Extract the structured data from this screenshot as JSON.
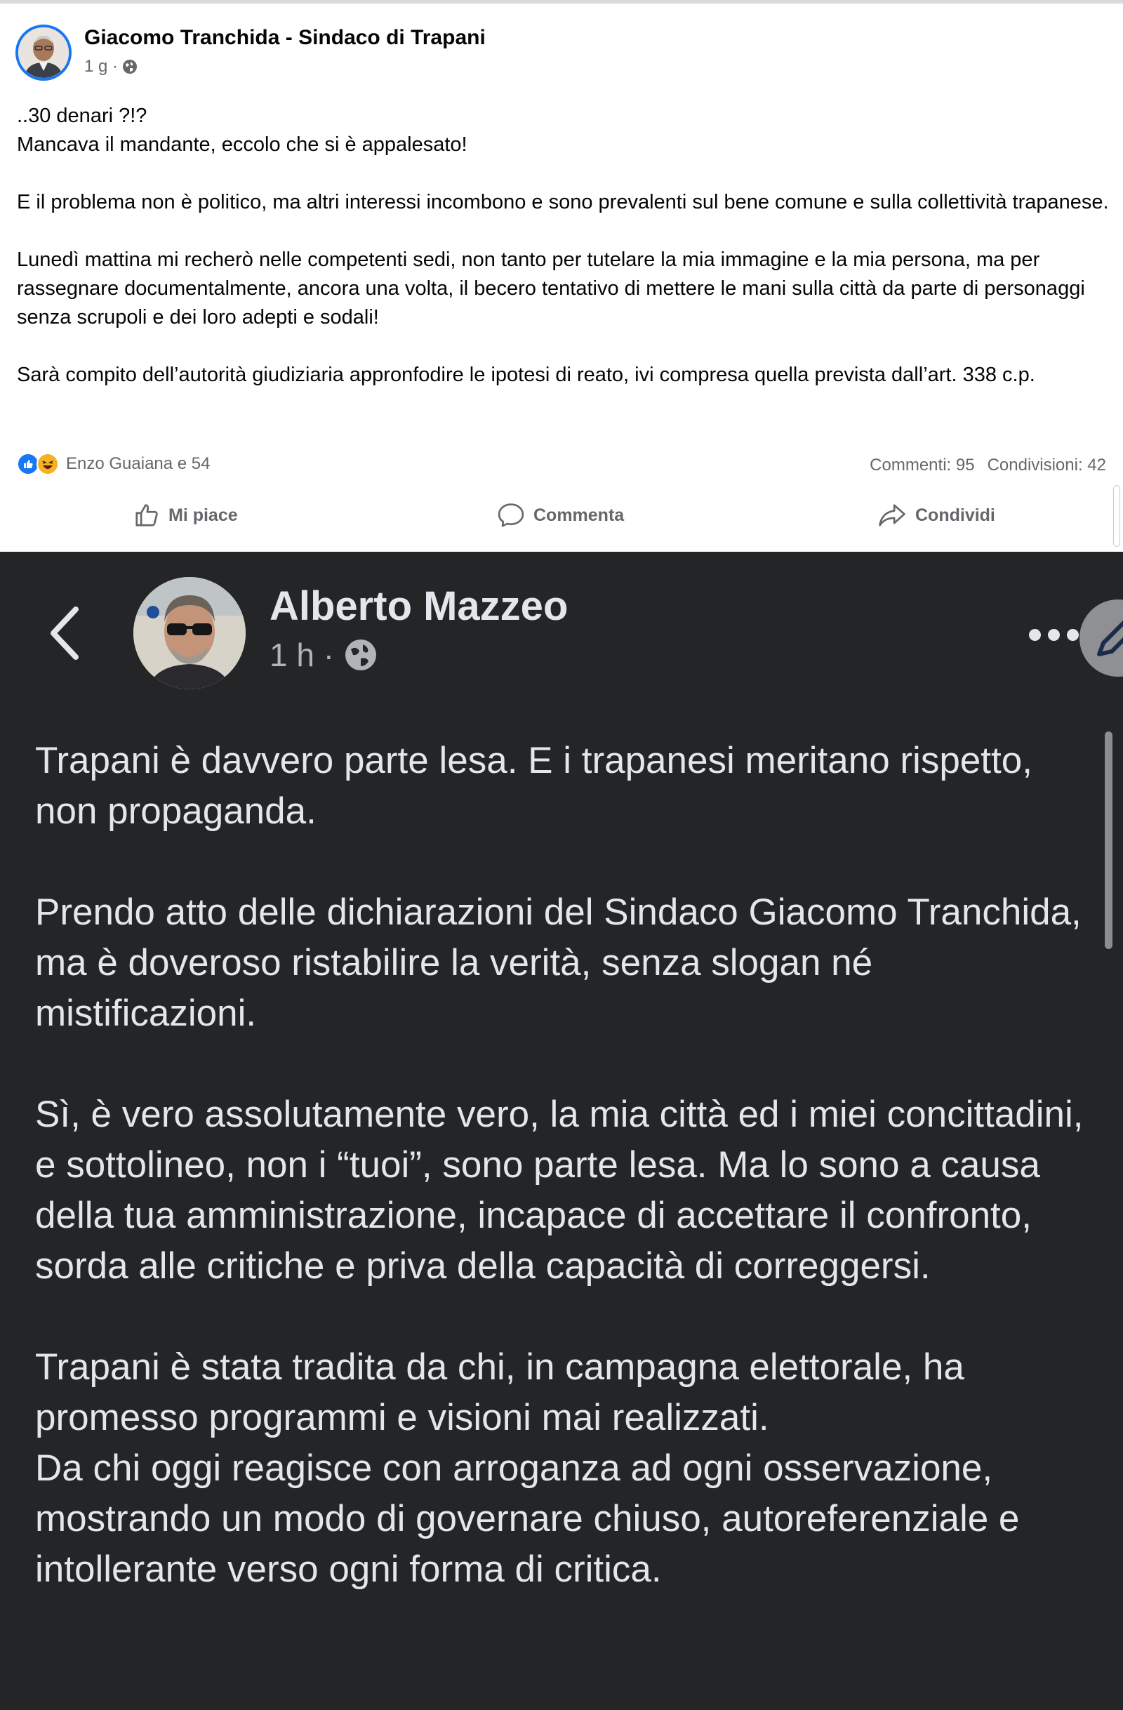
{
  "top_post": {
    "author": "Giacomo Tranchida - Sindaco di Trapani",
    "time": "1 g ·",
    "paragraphs": [
      "..30 denari ?!?\nMancava il mandante, eccolo che si è appalesato!",
      "E il problema non è politico, ma altri interessi incombono e sono prevalenti sul bene comune e sulla collettività trapanese.",
      "Lunedì mattina mi recherò nelle competenti sedi, non tanto per tutelare la mia immagine e la mia persona, ma per rassegnare  documentalmente, ancora una volta,  il becero tentativo di mettere le mani sulla città da parte di personaggi senza scrupoli e dei loro adepti e sodali!",
      "Sarà compito dell’autorità giudiziaria appronfodire le ipotesi di reato, ivi compresa quella prevista dall’art. 338 c.p."
    ],
    "reactions_text": "Enzo Guaiana e 54",
    "comments": "Commenti: 95",
    "shares": "Condivisioni: 42",
    "actions": {
      "like": "Mi piace",
      "comment": "Commenta",
      "share": "Condividi"
    },
    "icons": {
      "audience": "globe-icon",
      "like": "like-icon",
      "comment": "comment-icon",
      "share": "share-icon"
    }
  },
  "bottom_post": {
    "author": "Alberto Mazzeo",
    "time": "1 h ·",
    "paragraphs": [
      "Trapani è davvero parte lesa. E i trapanesi meritano rispetto, non propaganda.",
      "Prendo atto delle dichiarazioni del Sindaco Giacomo Tranchida, ma è doveroso ristabilire la verità, senza slogan né mistificazioni.",
      "Sì, è vero assolutamente vero, la mia città ed i miei concittadini, e sottolineo, non i “tuoi”, sono parte lesa. Ma lo sono a causa della tua amministrazione, incapace di accettare il confronto, sorda alle critiche e priva della capacità di correggersi.",
      "Trapani è stata tradita da chi, in campagna elettorale, ha promesso programmi e visioni mai realizzati.\nDa chi oggi reagisce con arroganza ad ogni osservazione, mostrando un modo di governare chiuso, autoreferenziale e intollerante verso ogni forma di critica."
    ],
    "icons": {
      "back": "chevron-left-icon",
      "audience": "globe-icon",
      "more": "more-dots-icon",
      "edit": "edit-icon"
    }
  },
  "colors": {
    "facebook_blue": "#1877f2",
    "dark_bg": "#242526",
    "dark_text": "#e4e6eb",
    "muted_text": "#65676b"
  }
}
